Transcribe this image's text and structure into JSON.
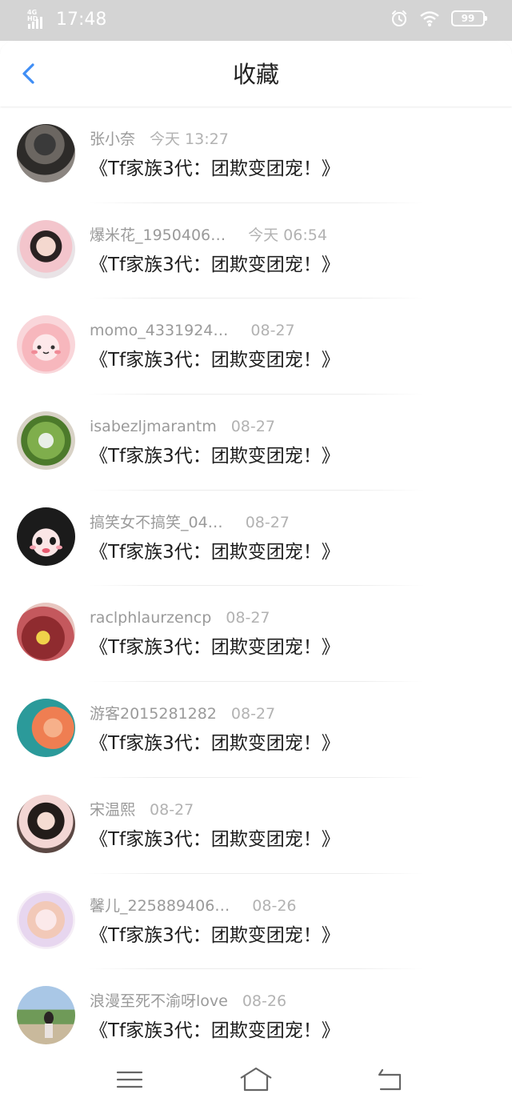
{
  "status_bar": {
    "network": "4G HD",
    "time": "17:48",
    "battery": "99",
    "icons": [
      "signal-icon",
      "alarm-icon",
      "wifi-icon",
      "battery-icon"
    ]
  },
  "header": {
    "title": "收藏",
    "back_icon": "chevron-left-icon",
    "accent_color": "#3f8ef5"
  },
  "favorites": [
    {
      "user": "张小奈",
      "date": "今天 13:27",
      "book": "《Tf家族3代：团欺变团宠！》",
      "avatar": "avatar-dark-hoodie"
    },
    {
      "user": "爆米花_1950406…",
      "date": "今天 06:54",
      "book": "《Tf家族3代：团欺变团宠！》",
      "avatar": "avatar-girl-pink"
    },
    {
      "user": "momo_4331924…",
      "date": "08-27",
      "book": "《Tf家族3代：团欺变团宠！》",
      "avatar": "avatar-pink-blob"
    },
    {
      "user": "isabezljmarantm",
      "date": "08-27",
      "book": "《Tf家族3代：团欺变团宠！》",
      "avatar": "avatar-food-bowl"
    },
    {
      "user": "搞笑女不搞笑_04…",
      "date": "08-27",
      "book": "《Tf家族3代：团欺变团宠！》",
      "avatar": "avatar-cartoon-girl"
    },
    {
      "user": "raclphlaurzencp",
      "date": "08-27",
      "book": "《Tf家族3代：团欺变团宠！》",
      "avatar": "avatar-jar-ducks"
    },
    {
      "user": "游客2015281282",
      "date": "08-27",
      "book": "《Tf家族3代：团欺变团宠！》",
      "avatar": "avatar-teal-orange"
    },
    {
      "user": "宋温熙",
      "date": "08-27",
      "book": "《Tf家族3代：团欺变团宠！》",
      "avatar": "avatar-girl-portrait"
    },
    {
      "user": "馨儿_225889406…",
      "date": "08-26",
      "book": "《Tf家族3代：团欺变团宠！》",
      "avatar": "avatar-anime-girl"
    },
    {
      "user": "浪漫至死不渝呀love",
      "date": "08-26",
      "book": "《Tf家族3代：团欺变团宠！》",
      "avatar": "avatar-outdoor-girl"
    }
  ],
  "system_nav": {
    "icons": [
      "menu-icon",
      "home-icon",
      "back-icon"
    ]
  }
}
